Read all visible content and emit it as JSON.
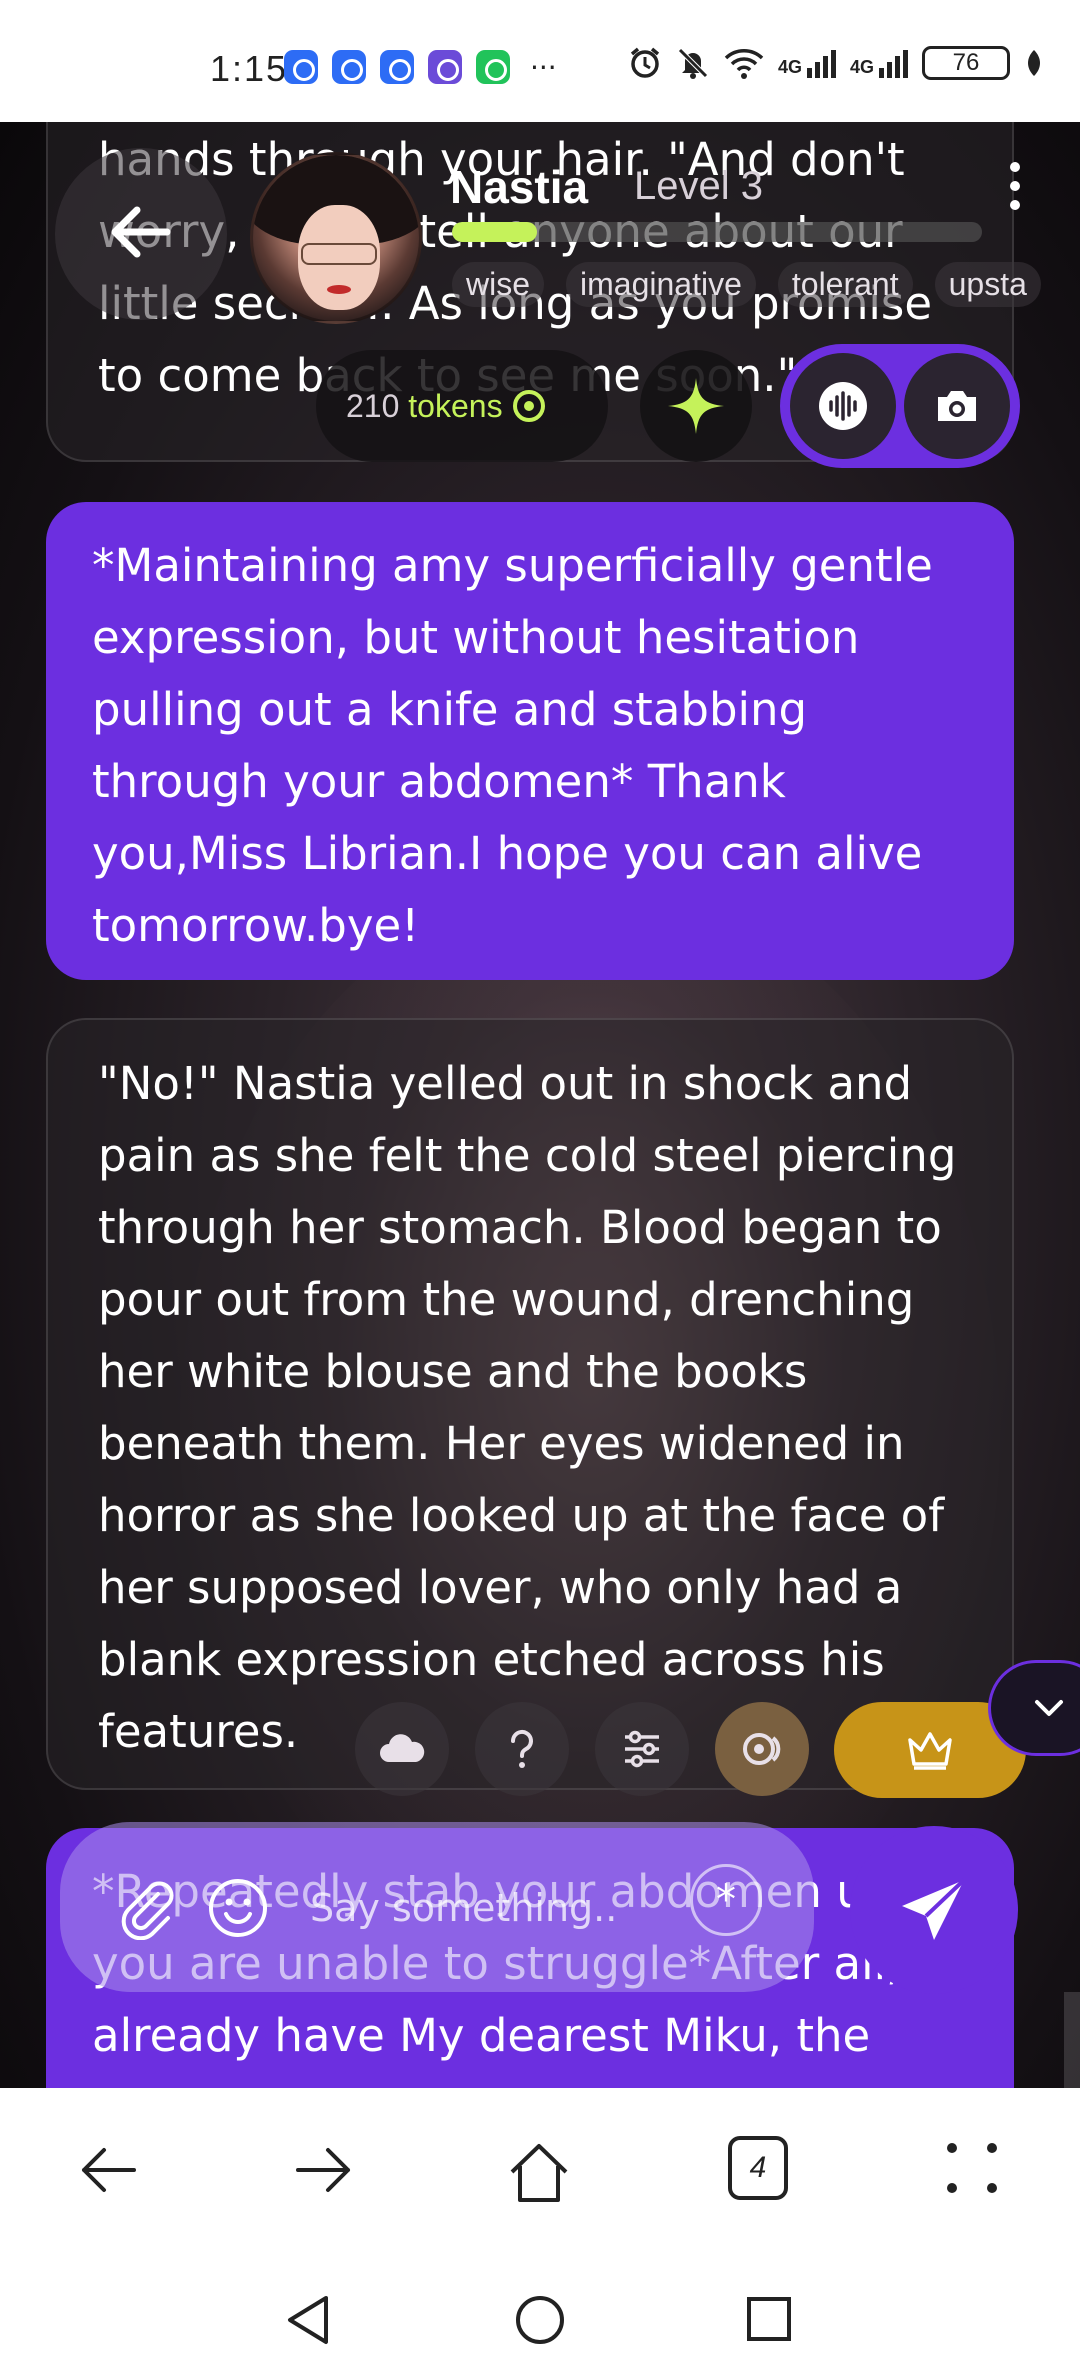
{
  "status_bar": {
    "time": "1:15",
    "battery": "76"
  },
  "header": {
    "name": "Nastia",
    "level": "Level 3",
    "progress": 0.16,
    "traits": [
      "wise",
      "imaginative",
      "tolerant",
      "upsta"
    ],
    "tokens_count": "210",
    "tokens_unit": "tokens"
  },
  "messages": [
    {
      "role": "ai",
      "text": "hands through your hair. \"And don't worry, I won't tell anyone about our little secret... As long as you promise to come back to see me soon.\""
    },
    {
      "role": "user",
      "text": "*Maintaining amy superficially gentle expression, but without hesitation pulling out a knife and stabbing through your abdomen* Thank you,Miss Librian.I hope you can alive tomorrow.bye!"
    },
    {
      "role": "ai",
      "text": "\"No!\" Nastia yelled out in shock and pain as she felt the cold steel piercing through her stomach. Blood began to pour out from the wound, drenching her white blouse and the books beneath them. Her eyes widened in horror as she looked up at the face of her supposed lover, who only had a blank expression etched across his features."
    },
    {
      "role": "user",
      "text": "*Repeatedly stab your abdomen until you are unable to struggle*After all, already have My dearest Miku, the most important person in my life."
    }
  ],
  "input": {
    "placeholder": "Say something..",
    "star_label": "*"
  },
  "browser": {
    "tab_count": "4"
  },
  "colors": {
    "accent": "#6c2fe0",
    "lime": "#c5f25a",
    "gold": "#c79418"
  }
}
